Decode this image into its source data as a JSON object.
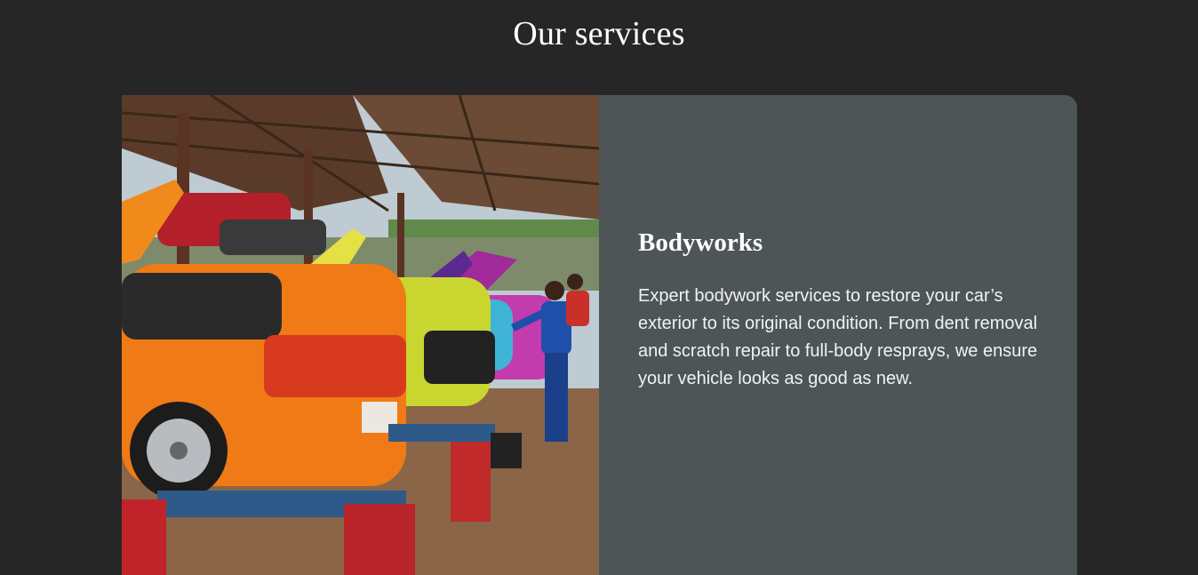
{
  "section": {
    "title": "Our services"
  },
  "service": {
    "title": "Bodyworks",
    "description": "Expert bodywork services to restore your car’s exterior to its original condition. From dent removal and scratch repair to full-body resprays, we ensure your vehicle looks as good as new.",
    "image_alt": "Mechanic working on colorful cars in an open-air garage"
  }
}
